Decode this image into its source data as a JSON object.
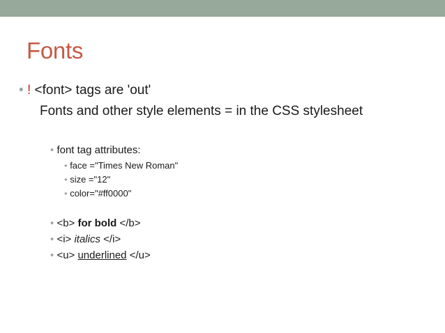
{
  "colors": {
    "topbar": "#96a99a",
    "title": "#c65a45",
    "bullet": "#9aa9a0",
    "exclamation": "#c0301e"
  },
  "slide": {
    "title": "Fonts",
    "bullet_glyph": "•",
    "item1": {
      "mark": "!",
      "text": " <font> tags are 'out'"
    },
    "item1_continuation": "Fonts and other style elements = in the CSS stylesheet",
    "font_attributes": {
      "heading": "font tag attributes:",
      "items": [
        "face =\"Times New Roman\"",
        "size =\"12\"",
        "color=\"#ff0000\""
      ]
    },
    "bold": {
      "open": "<b> ",
      "text": "for bold",
      "close": " </b>"
    },
    "italic": {
      "open": "<i> ",
      "text": "italics",
      "close": " </i>"
    },
    "underline": {
      "open": " <u> ",
      "text": "underlined",
      "close": " </u>"
    }
  }
}
